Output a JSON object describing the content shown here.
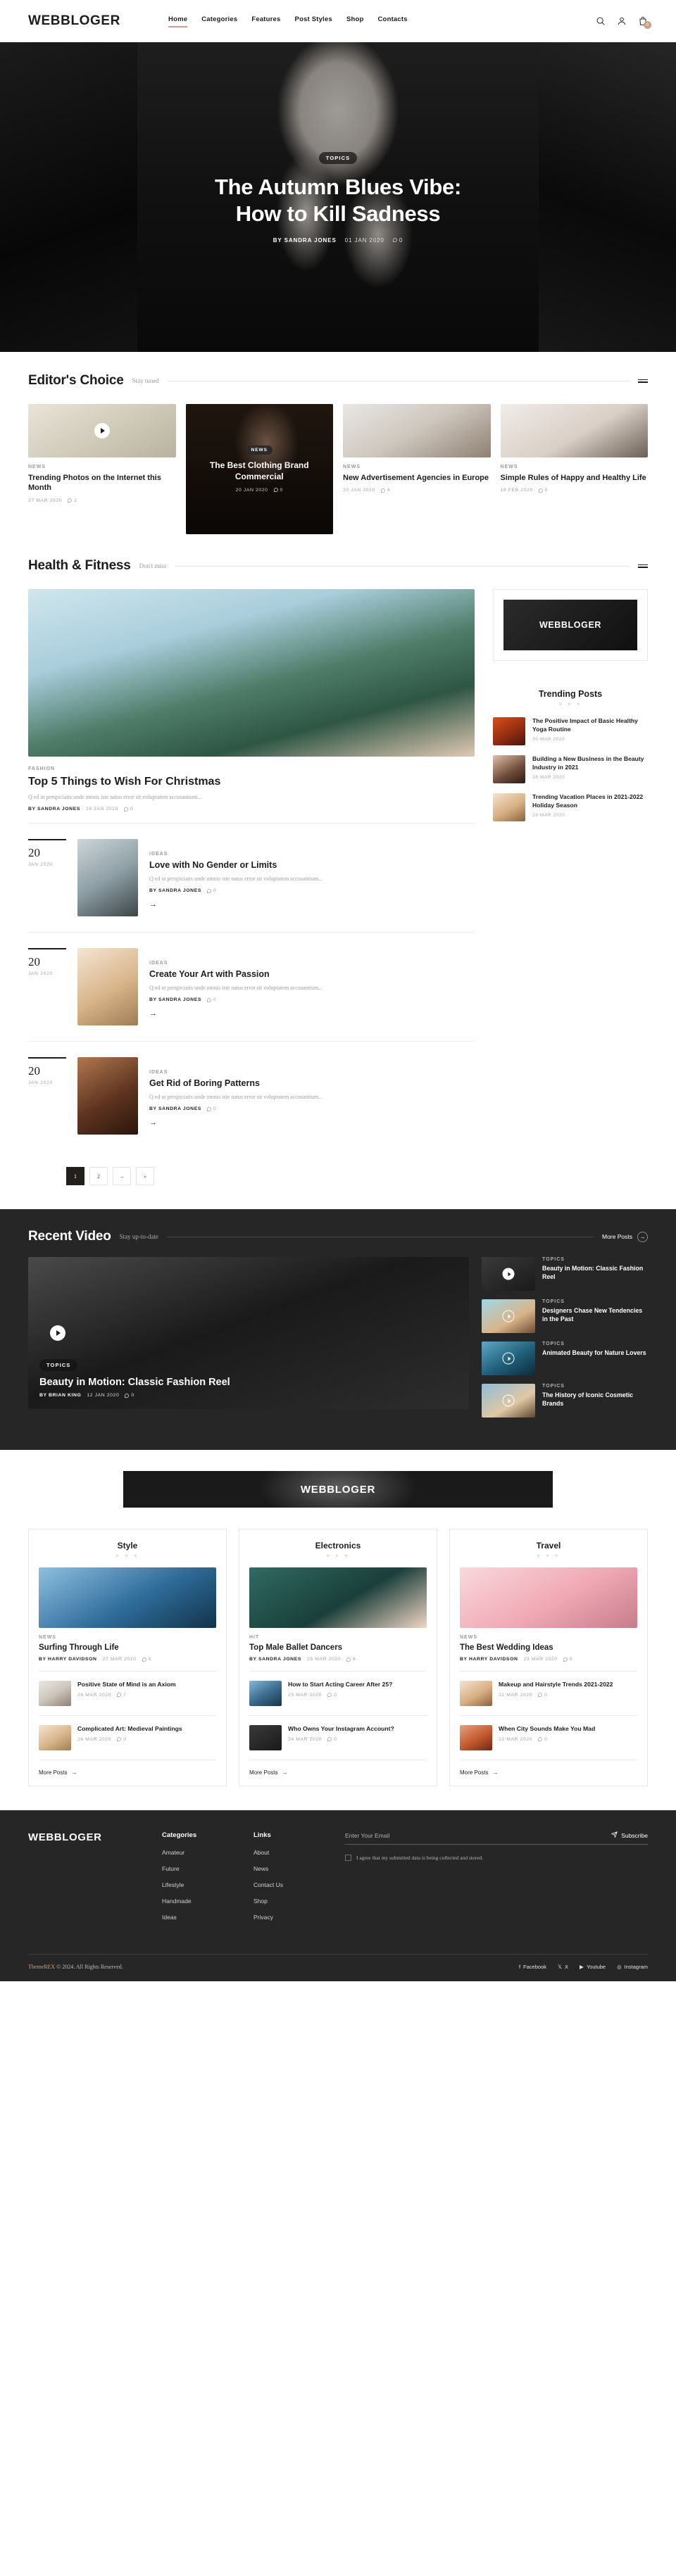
{
  "header": {
    "logo": "WEBBLOGER",
    "nav": [
      {
        "label": "Home",
        "active": true
      },
      {
        "label": "Categories",
        "active": false
      },
      {
        "label": "Features",
        "active": false
      },
      {
        "label": "Post Styles",
        "active": false
      },
      {
        "label": "Shop",
        "active": false
      },
      {
        "label": "Contacts",
        "active": false
      }
    ],
    "cart_count": "0"
  },
  "hero": {
    "tag": "TOPICS",
    "title_line1": "The Autumn Blues Vibe:",
    "title_line2": "How to Kill Sadness",
    "author": "BY SANDRA JONES",
    "date": "01 JAN 2020",
    "comments": "0"
  },
  "editors_choice": {
    "title": "Editor's Choice",
    "subtitle": "Stay tuned",
    "cards": [
      {
        "category": "NEWS",
        "title": "Trending Photos on the Internet this Month",
        "date": "27 MAR 2020",
        "comments": "2",
        "has_play": true
      },
      {
        "category": "NEWS",
        "title": "The Best Clothing Brand Commercial",
        "date": "20 JAN 2020",
        "comments": "0",
        "featured": true
      },
      {
        "category": "NEWS",
        "title": "New Advertisement Agencies in Europe",
        "date": "20 JAN 2020",
        "comments": "4"
      },
      {
        "category": "NEWS",
        "title": "Simple Rules of Happy and Healthy Life",
        "date": "19 FEB 2020",
        "comments": "0"
      }
    ]
  },
  "health_fitness": {
    "title": "Health & Fitness",
    "subtitle": "Don't miss",
    "featured": {
      "category": "FASHION",
      "title": "Top 5 Things to Wish For Christmas",
      "excerpt": "Q ed ut perspiciatis unde omnis iste natus error sit voluptatem accusantium...",
      "author": "BY SANDRA JONES",
      "date": "16 JAN 2020",
      "comments": "0"
    },
    "badge_logo": "WEBBLOGER",
    "trending": {
      "title": "Trending Posts",
      "ornament": "× × ×",
      "items": [
        {
          "title": "The Positive Impact of Basic Healthy Yoga Routine",
          "date": "30 MAR 2020"
        },
        {
          "title": "Building a New Business in the Beauty Industry in 2021",
          "date": "28 MAR 2020"
        },
        {
          "title": "Trending Vacation Places in 2021-2022 Holiday Season",
          "date": "28 MAR 2020"
        }
      ]
    },
    "posts": [
      {
        "day": "20",
        "month": "JAN 2020",
        "category": "IDEAS",
        "title": "Love with No Gender or Limits",
        "excerpt": "Q ed ut perspiciatis unde omnis iste natus error sit voluptatem accusantium...",
        "author": "BY SANDRA JONES",
        "comments": "0",
        "arrow": "→"
      },
      {
        "day": "20",
        "month": "JAN 2020",
        "category": "IDEAS",
        "title": "Create Your Art with Passion",
        "excerpt": "Q ed ut perspiciatis unde omnis iste natus error sit voluptatem accusantium...",
        "author": "BY SANDRA JONES",
        "comments": "0",
        "arrow": "→"
      },
      {
        "day": "20",
        "month": "JAN 2020",
        "category": "IDEAS",
        "title": "Get Rid of Boring Patterns",
        "excerpt": "Q ed ut perspiciatis unde omnis iste natus error sit voluptatem accusantium...",
        "author": "BY SANDRA JONES",
        "comments": "0",
        "arrow": "→"
      }
    ],
    "pagination": [
      "1",
      "2",
      "→",
      "»"
    ]
  },
  "recent_video": {
    "title": "Recent Video",
    "subtitle": "Stay up-to-date",
    "more_label": "More Posts",
    "more_arrow": "→",
    "main": {
      "tag": "TOPICS",
      "title": "Beauty in Motion: Classic Fashion Reel",
      "author": "BY BRIAN KING",
      "date": "12 JAN 2020",
      "comments": "0"
    },
    "list": [
      {
        "category": "TOPICS",
        "title": "Beauty in Motion: Classic Fashion Reel"
      },
      {
        "category": "TOPICS",
        "title": "Designers Chase New Tendencies in the Past"
      },
      {
        "category": "TOPICS",
        "title": "Animated Beauty for Nature Lovers"
      },
      {
        "category": "TOPICS",
        "title": "The History of Iconic Cosmetic Brands"
      }
    ]
  },
  "promo": {
    "logo": "WEBBLOGER"
  },
  "columns": [
    {
      "title": "Style",
      "ornament": "× × ×",
      "lead": {
        "category": "NEWS",
        "title": "Surfing Through Life",
        "author": "BY HARRY DAVIDSON",
        "date": "27 MAR 2020",
        "comments": "0"
      },
      "items": [
        {
          "title": "Positive State of Mind is an Axiom",
          "date": "26 MAR 2020",
          "comments": "7"
        },
        {
          "title": "Complicated Art: Medieval Paintings",
          "date": "26 MAR 2020",
          "comments": "0"
        }
      ],
      "more": "More Posts",
      "more_arrow": "→"
    },
    {
      "title": "Electronics",
      "ornament": "× × ×",
      "lead": {
        "category": "HIT",
        "title": "Top Male Ballet Dancers",
        "author": "BY SANDRA JONES",
        "date": "25 MAR 2020",
        "comments": "6"
      },
      "items": [
        {
          "title": "How to Start Acting Career After 25?",
          "date": "25 MAR 2020",
          "comments": "0"
        },
        {
          "title": "Who Owns Your Instagram Account?",
          "date": "24 MAR 2020",
          "comments": "0"
        }
      ],
      "more": "More Posts",
      "more_arrow": "→"
    },
    {
      "title": "Travel",
      "ornament": "× × ×",
      "lead": {
        "category": "NEWS",
        "title": "The Best Wedding Ideas",
        "author": "BY HARRY DAVIDSON",
        "date": "23 MAR 2020",
        "comments": "0"
      },
      "items": [
        {
          "title": "Makeup and Hairstyle Trends 2021-2022",
          "date": "22 MAR 2020",
          "comments": "0"
        },
        {
          "title": "When City Sounds Make You Mad",
          "date": "22 MAR 2020",
          "comments": "0"
        }
      ],
      "more": "More Posts",
      "more_arrow": "→"
    }
  ],
  "footer": {
    "logo": "WEBBLOGER",
    "categories_title": "Categories",
    "categories": [
      "Amateur",
      "Future",
      "Lifestyle",
      "Handmade",
      "Ideas"
    ],
    "links_title": "Links",
    "links": [
      "About",
      "News",
      "Contact Us",
      "Shop",
      "Privacy"
    ],
    "email_placeholder": "Enter Your Email",
    "email_value": "",
    "subscribe_label": "Subscribe",
    "agree_text": "I agree that my submitted data is being collected and stored.",
    "copyright_brand": "ThemeREX",
    "copyright_rest": " © 2024. All Rights Reserved.",
    "socials": [
      "Facebook",
      "X",
      "Youtube",
      "Instagram"
    ]
  },
  "colors": {
    "accent": "#c9a18a",
    "dark": "#262626",
    "ink": "#1d1d1d"
  }
}
